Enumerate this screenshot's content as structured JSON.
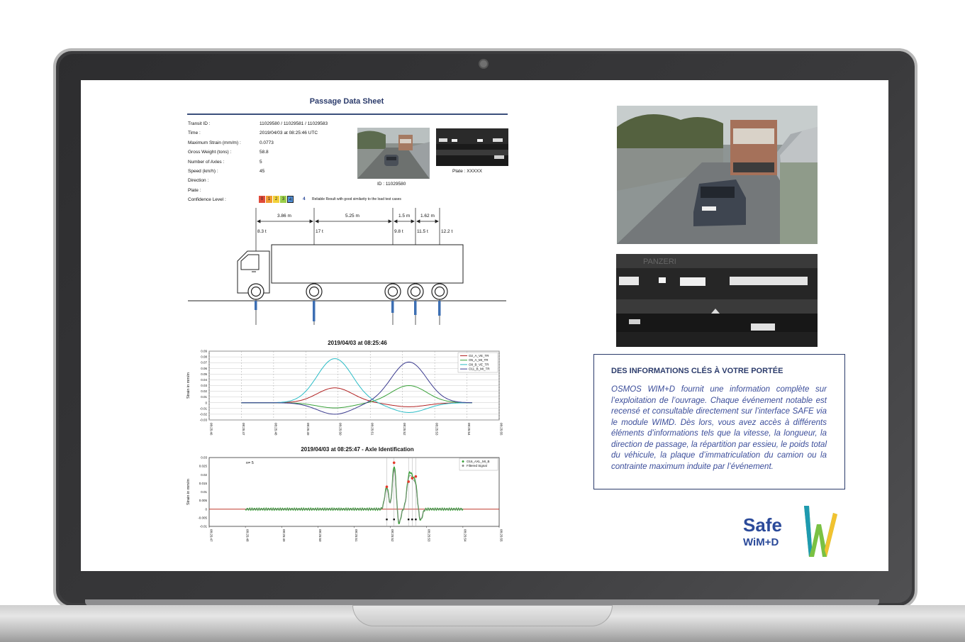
{
  "sheet": {
    "title": "Passage Data Sheet",
    "fields": [
      {
        "label": "Transit ID :",
        "value": "11029580 / 11029581 / 11029583"
      },
      {
        "label": "Time :",
        "value": "2019/04/03 at 08:25:46 UTC"
      },
      {
        "label": "Maximum Strain (mm/m) :",
        "value": "0.0773"
      },
      {
        "label": "Gross Weight (tons) :",
        "value": "58.8"
      },
      {
        "label": "Number of Axles :",
        "value": "5"
      },
      {
        "label": "Speed (km/h) :",
        "value": "45"
      },
      {
        "label": "Direction :",
        "value": ""
      },
      {
        "label": "Plate :",
        "value": ""
      },
      {
        "label": "Confidence Level :",
        "value": ""
      }
    ],
    "confidence_scale": [
      "0",
      "1",
      "2",
      "3",
      "4"
    ],
    "confidence_value": "4",
    "confidence_text": "Reliable Result with good similarity to the load test cases",
    "photo_id_caption": "ID : 11029580",
    "plate_caption": "Plate : XXXXX",
    "spacings": [
      "3.86 m",
      "5.25 m",
      "1.5 m",
      "1.62 m"
    ],
    "axle_loads": [
      "8.3 t",
      "17 t",
      "9.8 t",
      "11.5 t",
      "12.2 t"
    ]
  },
  "chart_data": [
    {
      "type": "line",
      "title": "2019/04/03 at 08:25:46",
      "ylabel": "Strain in mm/m",
      "ylim": [
        -0.03,
        0.09
      ],
      "y_ticks": [
        "0.09",
        "0.08",
        "0.07",
        "0.06",
        "0.05",
        "0.04",
        "0.03",
        "0.02",
        "0.01",
        "0",
        "-0.01",
        "-0.02",
        "-0.03"
      ],
      "x_ticks": [
        "08:25:46",
        "08:25:47",
        "08:25:48",
        "08:25:49",
        "08:25:50",
        "08:25:51",
        "08:25:52",
        "08:25:53",
        "08:25:54",
        "08:25:55"
      ],
      "grid": true,
      "legend": "top-right",
      "series": [
        {
          "name": "O2_A_VE_TR",
          "color": "#b22222",
          "peak": 0.026,
          "peak_time": "08:25:49.9",
          "trough": -0.007,
          "trough_time": "08:25:52.3"
        },
        {
          "name": "O5_A_MI_TR",
          "color": "#3aa23a",
          "peak": 0.03,
          "peak_time": "08:25:52.2",
          "trough": -0.009,
          "trough_time": "08:25:49.6"
        },
        {
          "name": "O8_B_VE_TR",
          "color": "#2bbcc6",
          "peak": 0.077,
          "peak_time": "08:25:49.9",
          "trough": -0.017,
          "trough_time": "08:25:52.3"
        },
        {
          "name": "O11_B_MI_TR",
          "color": "#3b3b8f",
          "peak": 0.071,
          "peak_time": "08:25:52.2",
          "trough": -0.02,
          "trough_time": "08:25:49.9"
        }
      ]
    },
    {
      "type": "line",
      "title": "2019/04/03 at 08:25:47 - Axle Identification",
      "ylabel": "Strain in mm/m",
      "ylim": [
        -0.01,
        0.03
      ],
      "y_ticks": [
        "0.03",
        "0.025",
        "0.02",
        "0.015",
        "0.01",
        "0.005",
        "0",
        "-0.005",
        "-0.01"
      ],
      "x_ticks": [
        "08:25:47",
        "08:25:48",
        "08:25:49",
        "08:25:50",
        "08:25:51",
        "08:25:52",
        "08:25:53",
        "08:25:54",
        "08:25:55"
      ],
      "annotation": "n= 5",
      "legend": "top-right",
      "series": [
        {
          "name": "O16_AXL_MI_B",
          "color": "#3aa23a"
        },
        {
          "name": "Filtered Signal",
          "color": "#888888"
        }
      ],
      "axle_peaks": [
        {
          "time": "08:25:51.9",
          "strain": 0.013
        },
        {
          "time": "08:25:52.1",
          "strain": 0.027
        },
        {
          "time": "08:25:52.5",
          "strain": 0.016
        },
        {
          "time": "08:25:52.6",
          "strain": 0.018
        },
        {
          "time": "08:25:52.7",
          "strain": 0.019
        }
      ]
    }
  ],
  "card": {
    "title": "DES INFORMATIONS CLÉS À VOTRE PORTÉE",
    "body": "OSMOS WIM+D fournit une information complète sur l’exploitation de l’ouvrage. Chaque événement notable est recensé et consultable directement sur l’interface SAFE via le module WIMD. Dès lors, vous avez accès à différents éléments d’informations tels que la vitesse, la longueur, la direction de passage, la répartition par essieu, le poids total du véhicule, la plaque d’immatriculation du camion ou la contrainte maximum induite par l’événement."
  },
  "logo": {
    "word": "Safe",
    "sub": "WiM+D",
    "colors": {
      "blue": "#2b4a9a",
      "green": "#7ac143",
      "yellow": "#f2c230",
      "teal": "#1e9ab0"
    }
  }
}
